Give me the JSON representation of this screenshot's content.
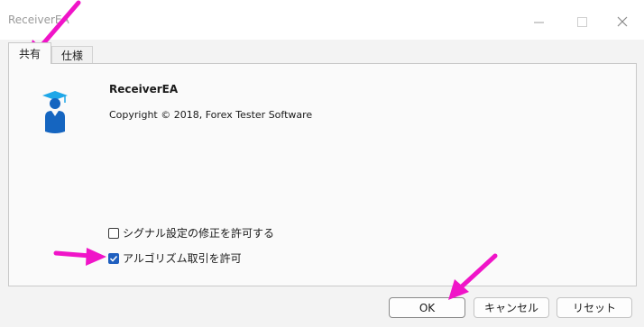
{
  "window": {
    "title": "ReceiverEA"
  },
  "tabs": [
    {
      "label": "共有",
      "active": true
    },
    {
      "label": "仕様",
      "active": false
    }
  ],
  "app": {
    "name": "ReceiverEA",
    "copyright": "Copyright © 2018, Forex Tester Software",
    "icon": "graduate-user-icon"
  },
  "options": [
    {
      "label": "シグナル設定の修正を許可する",
      "checked": false
    },
    {
      "label": "アルゴリズム取引を許可",
      "checked": true
    }
  ],
  "buttons": {
    "ok": "OK",
    "cancel": "キャンセル",
    "reset": "リセット"
  },
  "colors": {
    "annotation_arrow": "#f014c8",
    "checkbox_accent": "#1f5fbf",
    "icon_blue": "#1565c0"
  }
}
